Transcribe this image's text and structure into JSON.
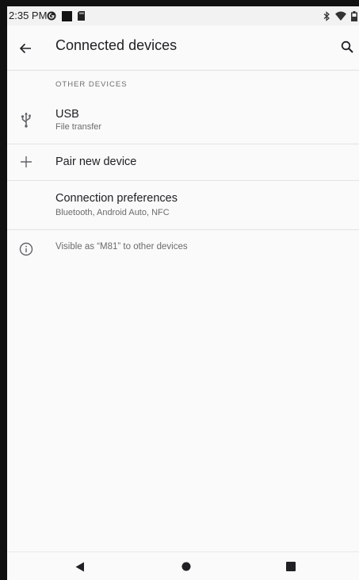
{
  "status_bar": {
    "time": "2:35 PM",
    "left_icons": [
      "google-icon",
      "square-icon",
      "sdcard-icon"
    ],
    "right_icons": [
      "bluetooth-icon",
      "wifi-icon",
      "battery-icon"
    ]
  },
  "toolbar": {
    "title": "Connected devices",
    "back_icon": "arrow-back-icon",
    "search_icon": "search-icon"
  },
  "section": {
    "header": "OTHER DEVICES"
  },
  "items": [
    {
      "icon": "usb-icon",
      "title": "USB",
      "subtitle": "File transfer"
    },
    {
      "icon": "plus-icon",
      "title": "Pair new device",
      "subtitle": ""
    },
    {
      "icon": "",
      "title": "Connection preferences",
      "subtitle": "Bluetooth, Android Auto, NFC"
    }
  ],
  "footer": {
    "icon": "info-icon",
    "text": "Visible as “M81” to other devices"
  },
  "nav_bar": {
    "buttons": [
      "back-triangle-icon",
      "home-circle-icon",
      "recents-square-icon"
    ]
  },
  "colors": {
    "background": "#fafafa",
    "text_primary": "#202124",
    "text_secondary": "#6b6b6b",
    "divider": "#e3e3e3",
    "bezel": "#111111"
  }
}
